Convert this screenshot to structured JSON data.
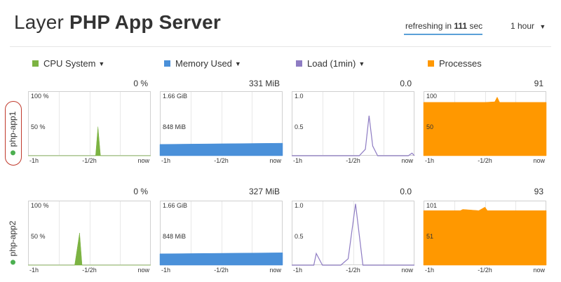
{
  "header": {
    "title_prefix": "Layer",
    "title_main": "PHP App Server",
    "refresh_prefix": "refreshing in",
    "refresh_seconds": "111",
    "refresh_suffix": "sec",
    "range_label": "1 hour",
    "range_caret": "chevron-down-icon"
  },
  "legend": [
    {
      "label": "CPU System",
      "color": "#7cb342",
      "has_caret": true
    },
    {
      "label": "Memory Used",
      "color": "#4a90d9",
      "has_caret": true
    },
    {
      "label": "Load (1min)",
      "color": "#8e7cc3",
      "has_caret": true
    },
    {
      "label": "Processes",
      "color": "#ff9800",
      "has_caret": false
    }
  ],
  "x_labels": [
    "-1h",
    "-1/2h",
    "now"
  ],
  "hosts": [
    {
      "name": "php-app1",
      "status_color": "#4caf50",
      "metrics": [
        {
          "value": "0 %",
          "ticks": [
            "100 %",
            "50 %"
          ]
        },
        {
          "value": "331 MiB",
          "ticks": [
            "1.66 GiB",
            "848 MiB"
          ]
        },
        {
          "value": "0.0",
          "ticks": [
            "1.0",
            "0.5"
          ]
        },
        {
          "value": "91",
          "ticks": [
            "100",
            "50"
          ]
        }
      ]
    },
    {
      "name": "php-app2",
      "status_color": "#4caf50",
      "metrics": [
        {
          "value": "0 %",
          "ticks": [
            "100 %",
            "50 %"
          ]
        },
        {
          "value": "327 MiB",
          "ticks": [
            "1.66 GiB",
            "848 MiB"
          ]
        },
        {
          "value": "0.0",
          "ticks": [
            "1.0",
            "0.5"
          ]
        },
        {
          "value": "93",
          "ticks": [
            "101",
            "51"
          ]
        }
      ]
    }
  ],
  "chart_data": [
    {
      "type": "area",
      "host": "php-app1",
      "series": "CPU System",
      "unit": "%",
      "ylim": [
        0,
        100
      ],
      "x": [
        0,
        0.55,
        0.57,
        0.59,
        1.0
      ],
      "y": [
        0,
        0,
        45,
        0,
        0
      ]
    },
    {
      "type": "area",
      "host": "php-app1",
      "series": "Memory Used",
      "unit": "MiB",
      "ylim": [
        0,
        1700
      ],
      "x": [
        0,
        1.0
      ],
      "y": [
        300,
        331
      ]
    },
    {
      "type": "line",
      "host": "php-app1",
      "series": "Load (1min)",
      "ylim": [
        0,
        1.0
      ],
      "x": [
        0,
        0.55,
        0.6,
        0.63,
        0.66,
        0.7,
        0.95,
        0.98,
        1.0
      ],
      "y": [
        0,
        0,
        0.1,
        0.62,
        0.15,
        0,
        0,
        0.04,
        0
      ]
    },
    {
      "type": "area",
      "host": "php-app1",
      "series": "Processes",
      "ylim": [
        0,
        110
      ],
      "x": [
        0,
        0.5,
        0.58,
        0.6,
        0.62,
        1.0
      ],
      "y": [
        91,
        91,
        92,
        100,
        91,
        91
      ]
    },
    {
      "type": "area",
      "host": "php-app2",
      "series": "CPU System",
      "unit": "%",
      "ylim": [
        0,
        100
      ],
      "x": [
        0,
        0.38,
        0.42,
        0.44,
        1.0
      ],
      "y": [
        0,
        0,
        50,
        0,
        0
      ]
    },
    {
      "type": "area",
      "host": "php-app2",
      "series": "Memory Used",
      "unit": "MiB",
      "ylim": [
        0,
        1700
      ],
      "x": [
        0,
        1.0
      ],
      "y": [
        300,
        327
      ]
    },
    {
      "type": "line",
      "host": "php-app2",
      "series": "Load (1min)",
      "ylim": [
        0,
        1.0
      ],
      "x": [
        0,
        0.18,
        0.2,
        0.25,
        0.4,
        0.46,
        0.52,
        0.58,
        1.0
      ],
      "y": [
        0,
        0,
        0.18,
        0,
        0,
        0.1,
        0.95,
        0,
        0
      ]
    },
    {
      "type": "area",
      "host": "php-app2",
      "series": "Processes",
      "ylim": [
        0,
        110
      ],
      "x": [
        0,
        0.3,
        0.32,
        0.45,
        0.5,
        0.52,
        1.0
      ],
      "y": [
        93,
        93,
        95,
        93,
        99,
        93,
        93
      ]
    }
  ]
}
